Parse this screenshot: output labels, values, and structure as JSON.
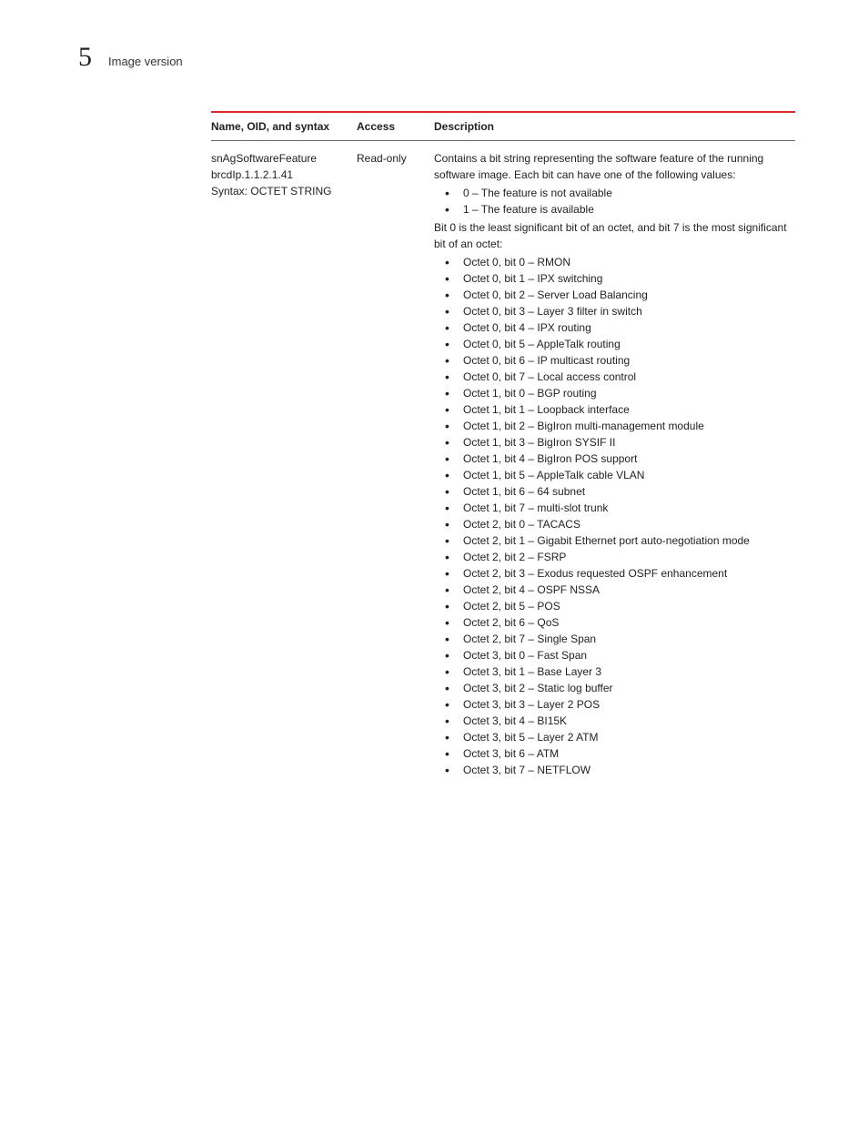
{
  "header": {
    "chapter_number": "5",
    "chapter_title": "Image version"
  },
  "table": {
    "headers": {
      "name": "Name, OID, and syntax",
      "access": "Access",
      "description": "Description"
    },
    "row": {
      "name_line1": "snAgSoftwareFeature",
      "name_line2": "brcdIp.1.1.2.1.41",
      "name_line3": "Syntax: OCTET STRING",
      "access": "Read-only",
      "desc_intro": "Contains a bit string representing the software feature of the running software image. Each bit can have one of the following values:",
      "value_bullets": [
        "0 – The feature is not available",
        "1 – The feature is available"
      ],
      "desc_bits_note": "Bit 0 is the least significant bit of an octet, and bit 7 is the most significant bit of an octet:",
      "octet_bullets": [
        "Octet 0, bit 0 – RMON",
        "Octet 0, bit 1 – IPX switching",
        "Octet 0, bit 2 – Server Load Balancing",
        "Octet 0, bit 3 – Layer 3 filter in switch",
        "Octet 0, bit 4 – IPX routing",
        "Octet 0, bit 5 – AppleTalk routing",
        "Octet 0, bit 6 – IP multicast routing",
        "Octet 0, bit 7 – Local access control",
        "Octet 1, bit 0 – BGP routing",
        "Octet 1, bit 1 – Loopback interface",
        "Octet 1, bit 2 – BigIron multi-management module",
        "Octet 1, bit 3 – BigIron SYSIF II",
        "Octet 1, bit 4 – BigIron POS support",
        "Octet 1, bit 5 – AppleTalk cable VLAN",
        "Octet 1, bit 6 – 64 subnet",
        "Octet 1, bit 7 – multi-slot trunk",
        "Octet 2, bit 0 – TACACS",
        "Octet 2, bit 1 – Gigabit Ethernet port auto-negotiation mode",
        "Octet 2, bit 2 – FSRP",
        "Octet 2, bit 3 – Exodus requested OSPF enhancement",
        "Octet 2, bit 4 – OSPF NSSA",
        "Octet 2, bit 5 – POS",
        "Octet 2, bit 6 – QoS",
        "Octet 2, bit 7 – Single Span",
        "Octet 3, bit 0 – Fast Span",
        "Octet 3, bit 1 – Base Layer 3",
        "Octet 3, bit 2 – Static log buffer",
        "Octet 3, bit 3 – Layer 2 POS",
        "Octet 3, bit 4 – BI15K",
        "Octet 3, bit 5 – Layer 2 ATM",
        "Octet 3, bit 6 – ATM",
        "Octet 3, bit 7 – NETFLOW"
      ]
    }
  }
}
